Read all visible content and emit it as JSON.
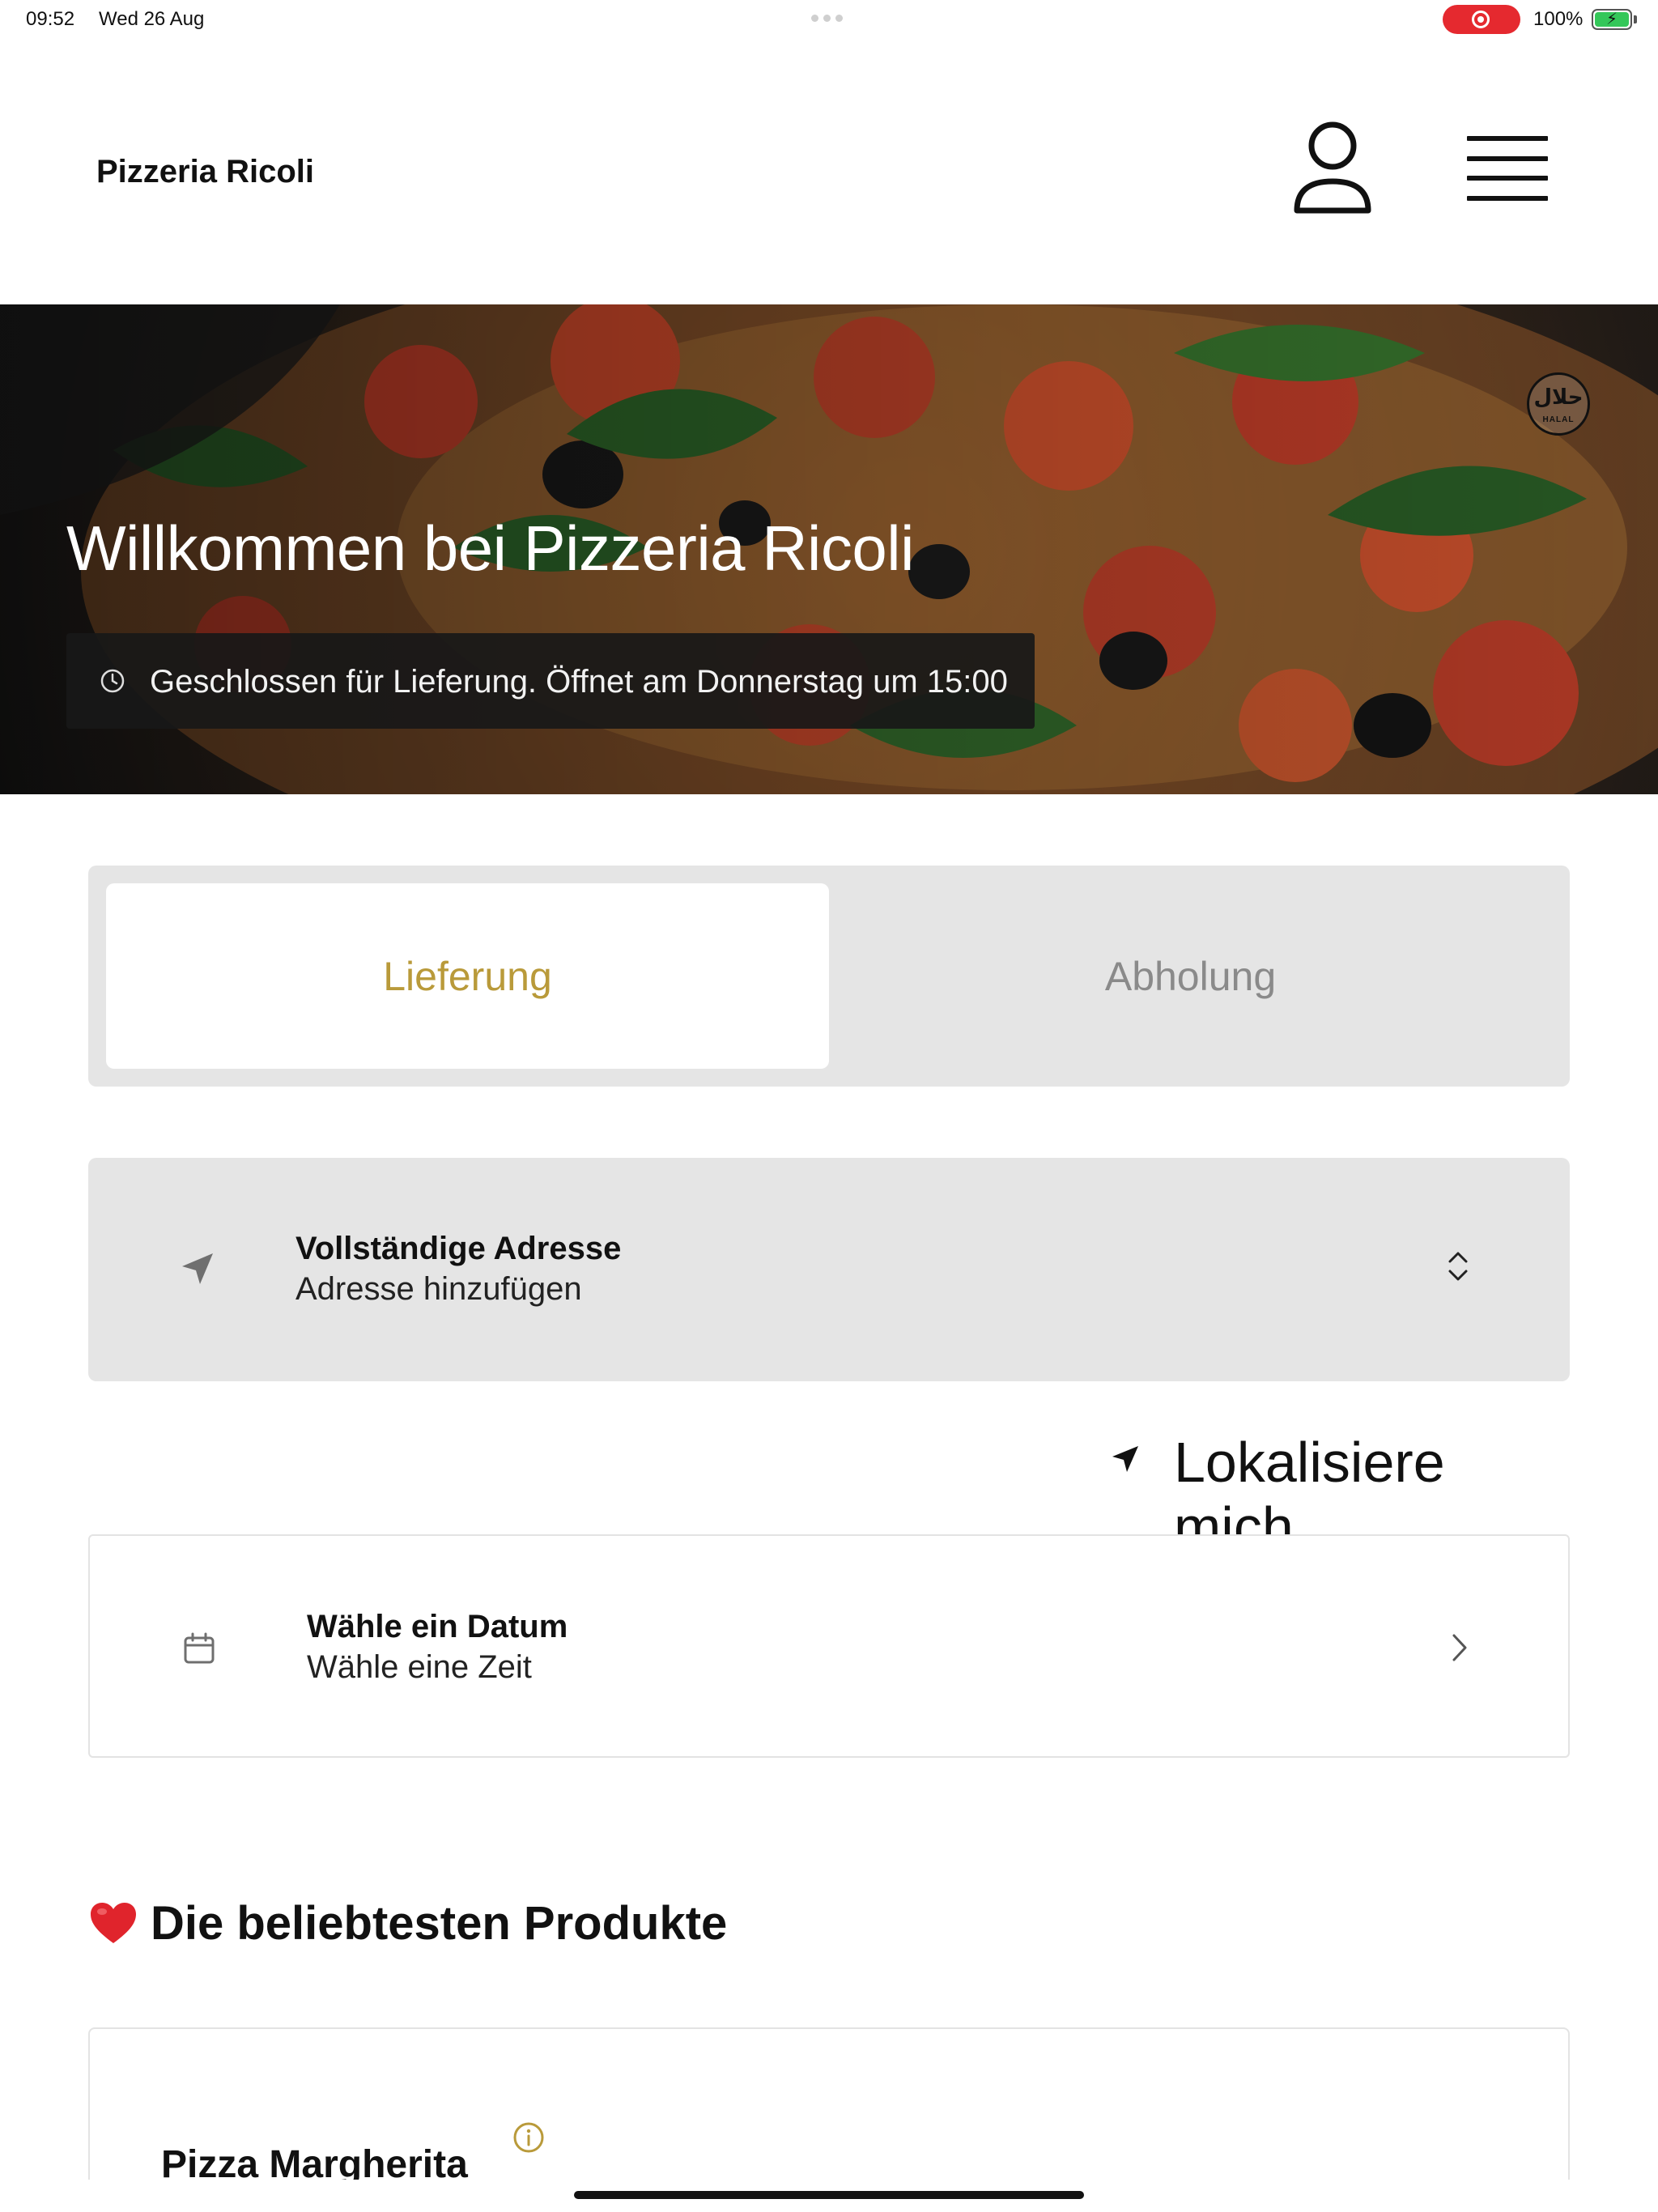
{
  "status_bar": {
    "time": "09:52",
    "date": "Wed 26 Aug",
    "battery": "100%"
  },
  "header": {
    "brand": "Pizzeria Ricoli",
    "user_icon": "user-icon",
    "menu_icon": "hamburger-menu-icon"
  },
  "hero": {
    "title": "Willkommen bei Pizzeria Ricoli",
    "status_text": "Geschlossen für Lieferung. Öffnet am Donnerstag um 15:00",
    "badge_arabic": "حلال",
    "badge_latin": "HALAL"
  },
  "order_mode": {
    "tabs": [
      {
        "label": "Lieferung",
        "active": true
      },
      {
        "label": "Abholung",
        "active": false
      }
    ],
    "active_color": "#b99a3a"
  },
  "address": {
    "title": "Vollständige Adresse",
    "subtitle": "Adresse hinzufügen"
  },
  "localize": {
    "label": "Lokalisiere mich"
  },
  "schedule": {
    "title": "Wähle ein Datum",
    "subtitle": "Wähle eine Zeit"
  },
  "popular": {
    "title": "Die beliebtesten Produkte",
    "products": [
      {
        "name": "Pizza Margherita"
      }
    ]
  }
}
